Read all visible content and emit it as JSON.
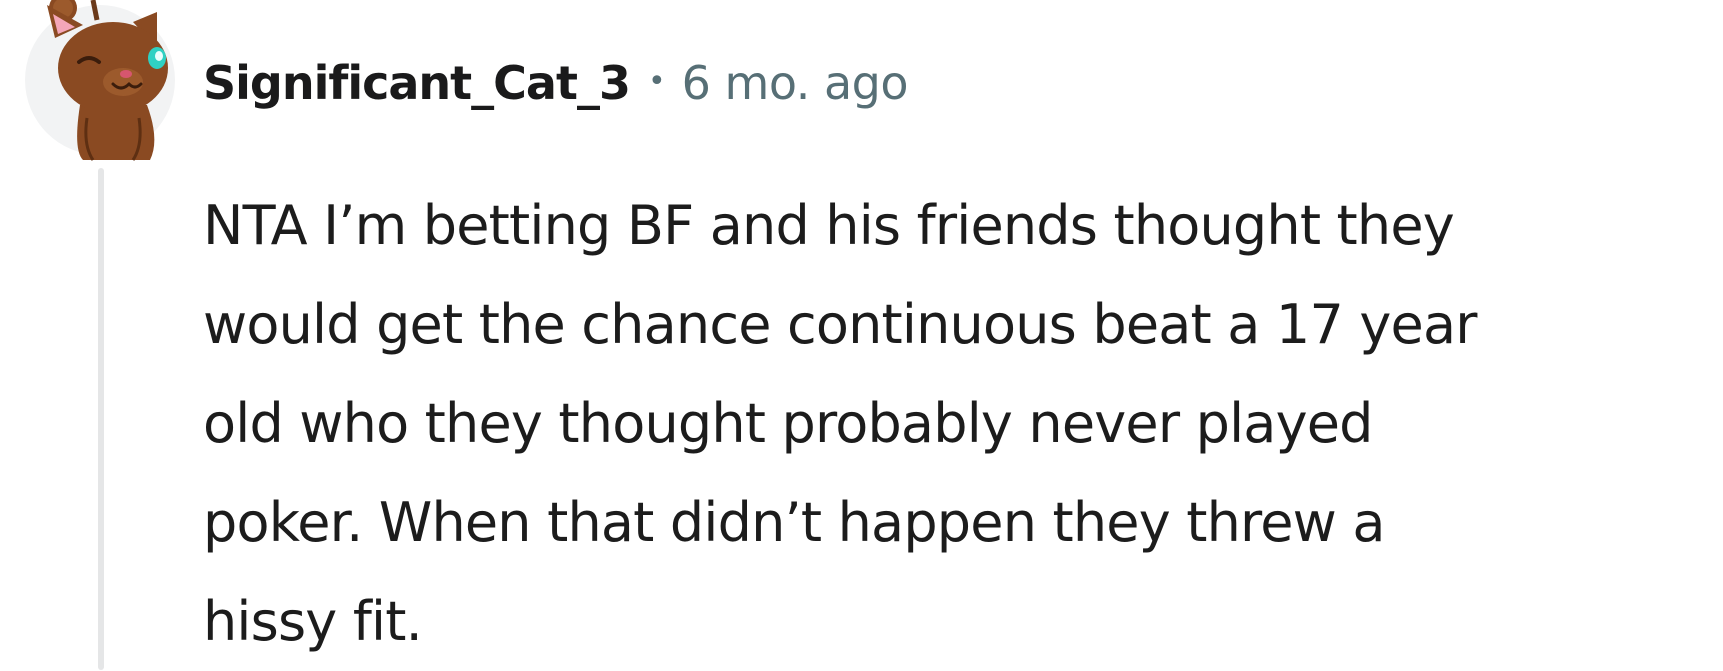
{
  "comment": {
    "author": "Significant_Cat_3",
    "separator": "•",
    "timestamp": "6 mo. ago",
    "body_lines": [
      "NTA I’m betting BF and his friends thought they",
      "would get the chance continuous beat a 17 year",
      "old who they thought probably never played",
      "poker. When that didn’t happen they threw a",
      "hissy fit."
    ]
  },
  "avatar": {
    "icon": "snoo-cat-avatar-icon",
    "background_color": "#f2f3f4",
    "fur_color": "#8a4a22",
    "eye_color": "#2fd1c3"
  },
  "colors": {
    "text": "#1c1c1c",
    "meta": "#576f76",
    "thread_line": "#e5e6e7"
  }
}
